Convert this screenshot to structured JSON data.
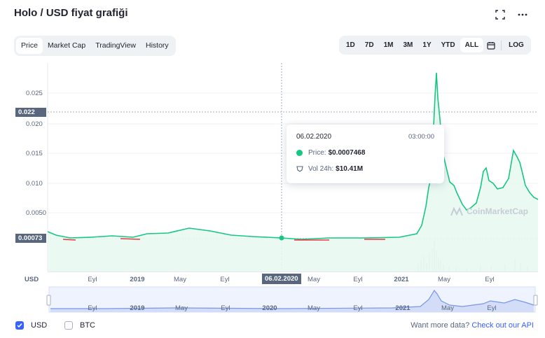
{
  "header": {
    "title": "Holo / USD fiyat grafiği",
    "fullscreen_icon": "fullscreen-icon",
    "more_icon": "more-horizontal-icon"
  },
  "tabs": [
    {
      "label": "Price",
      "active": true
    },
    {
      "label": "Market Cap",
      "active": false
    },
    {
      "label": "TradingView",
      "active": false
    },
    {
      "label": "History",
      "active": false
    }
  ],
  "ranges": [
    {
      "label": "1D",
      "active": false
    },
    {
      "label": "7D",
      "active": false
    },
    {
      "label": "1M",
      "active": false
    },
    {
      "label": "3M",
      "active": false
    },
    {
      "label": "1Y",
      "active": false
    },
    {
      "label": "YTD",
      "active": false
    },
    {
      "label": "ALL",
      "active": true
    }
  ],
  "log_label": "LOG",
  "calendar_icon": "calendar-icon",
  "colors": {
    "up": "#16c784",
    "down": "#ea3943",
    "axis_text": "#58667e",
    "accent": "#3861fb",
    "volume": "#cfd6e4",
    "navigator_fill": "#dbe5fb"
  },
  "chart_data": {
    "type": "line",
    "y_ticks": [
      "0.025",
      "0.020",
      "0.015",
      "0.010",
      "0.0050"
    ],
    "y_highlight_top": "0.022",
    "y_highlight_current": "0.00073",
    "ylim": [
      0,
      0.03
    ],
    "x_ticks": [
      "Eyl",
      "2019",
      "May",
      "Eyl",
      "May",
      "Eyl",
      "2021",
      "May",
      "Eyl"
    ],
    "x_highlight": "06.02.2020",
    "axis_currency": "USD",
    "watermark": "CoinMarketCap",
    "x": [
      "2018-05",
      "2018-09",
      "2019-01",
      "2019-05",
      "2019-09",
      "2020-01",
      "2020-05",
      "2020-09",
      "2021-01",
      "2021-03",
      "2021-04",
      "2021-05",
      "2021-07",
      "2021-09",
      "2021-11",
      "2022-01"
    ],
    "series": [
      {
        "values": [
          0.0012,
          0.0008,
          0.0009,
          0.0017,
          0.0009,
          0.0007,
          0.0006,
          0.0009,
          0.0011,
          0.005,
          0.028,
          0.013,
          0.006,
          0.011,
          0.015,
          0.0078
        ]
      }
    ]
  },
  "tooltip": {
    "date": "06.02.2020",
    "time": "03:00:00",
    "price_label": "Price:",
    "price_value": "$0.0007468",
    "vol_label": "Vol 24h:",
    "vol_value": "$10.41M"
  },
  "navigator": {
    "labels": [
      "Eyl",
      "2019",
      "May",
      "Eyl",
      "2020",
      "May",
      "Eyl",
      "2021",
      "May",
      "Eyl"
    ]
  },
  "legend": [
    {
      "label": "USD",
      "checked": true
    },
    {
      "label": "BTC",
      "checked": false
    }
  ],
  "api_text": "Want more data?",
  "api_link": "Check out our API"
}
